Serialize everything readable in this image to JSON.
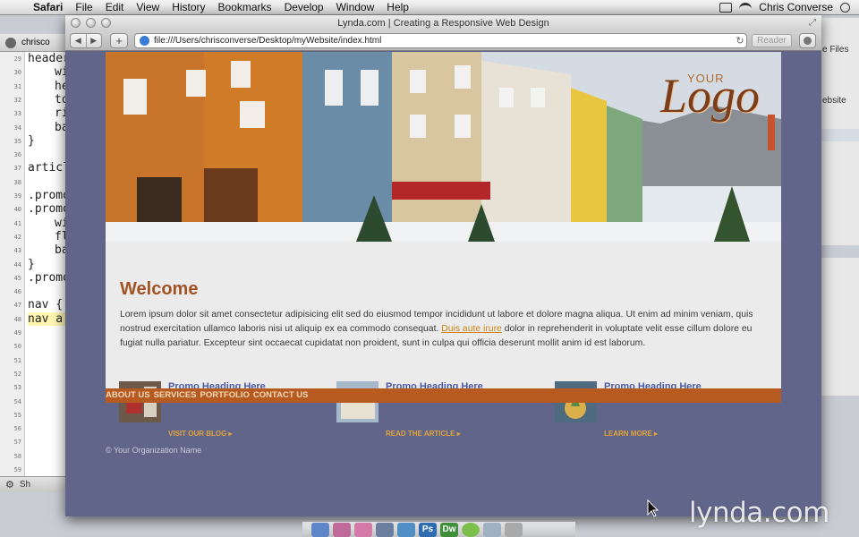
{
  "menubar": {
    "app_name": "Safari",
    "items": [
      "File",
      "Edit",
      "View",
      "History",
      "Bookmarks",
      "Develop",
      "Window",
      "Help"
    ],
    "user": "Chris Converse"
  },
  "editor": {
    "tab_label": "chrisco",
    "line_numbers": [
      "29",
      "30",
      "31",
      "32",
      "33",
      "34",
      "35",
      "36",
      "37",
      "38",
      "39",
      "40",
      "41",
      "42",
      "43",
      "44",
      "45",
      "46",
      "47",
      "48",
      "49",
      "50",
      "51",
      "52",
      "53",
      "54",
      "55",
      "56",
      "57",
      "58",
      "59"
    ],
    "code_lines": [
      "header",
      "wi",
      "he",
      "to",
      "ri",
      "ba",
      "}",
      "",
      "articl",
      "",
      ".promo",
      ".promo",
      "wi",
      "fl",
      "ba",
      "}",
      ".promo",
      "",
      "nav {",
      "nav a"
    ],
    "status_label": "Sh"
  },
  "right_window": {
    "label_1": "e Files",
    "label_2": "ebsite"
  },
  "safari": {
    "window_title": "Lynda.com | Creating a Responsive Web Design",
    "url": "file:///Users/chrisconverse/Desktop/myWebsite/index.html",
    "reader_label": "Reader",
    "add_label": "+",
    "back_label": "◀",
    "forward_label": "▶",
    "reload_label": "↻"
  },
  "website": {
    "logo_small": "YOUR",
    "logo_large": "Logo",
    "heading": "Welcome",
    "paragraph_before_link": "Lorem ipsum dolor sit amet consectetur adipisicing elit sed do eiusmod tempor incididunt ut labore et dolore magna aliqua. Ut enim ad minim veniam, quis nostrud exercitation ullamco laboris nisi ut aliquip ex ea commodo consequat. ",
    "paragraph_link": "Duis aute irure",
    "paragraph_after_link": " dolor in reprehenderit in voluptate velit esse cillum dolore eu fugiat nulla pariatur. Excepteur sint occaecat cupidatat non proident, sunt in culpa qui officia deserunt mollit anim id est laborum.",
    "nav_items": [
      "ABOUT US",
      "SERVICES",
      "PORTFOLIO",
      "CONTACT US"
    ],
    "promos": [
      {
        "heading": "Promo Heading Here",
        "link": "VISIT OUR BLOG ▸"
      },
      {
        "heading": "Promo Heading Here",
        "link": "READ THE ARTICLE ▸"
      },
      {
        "heading": "Promo Heading Here",
        "link": "LEARN MORE ▸"
      }
    ],
    "footer": "© Your Organization Name"
  },
  "watermark": "lynda.com"
}
